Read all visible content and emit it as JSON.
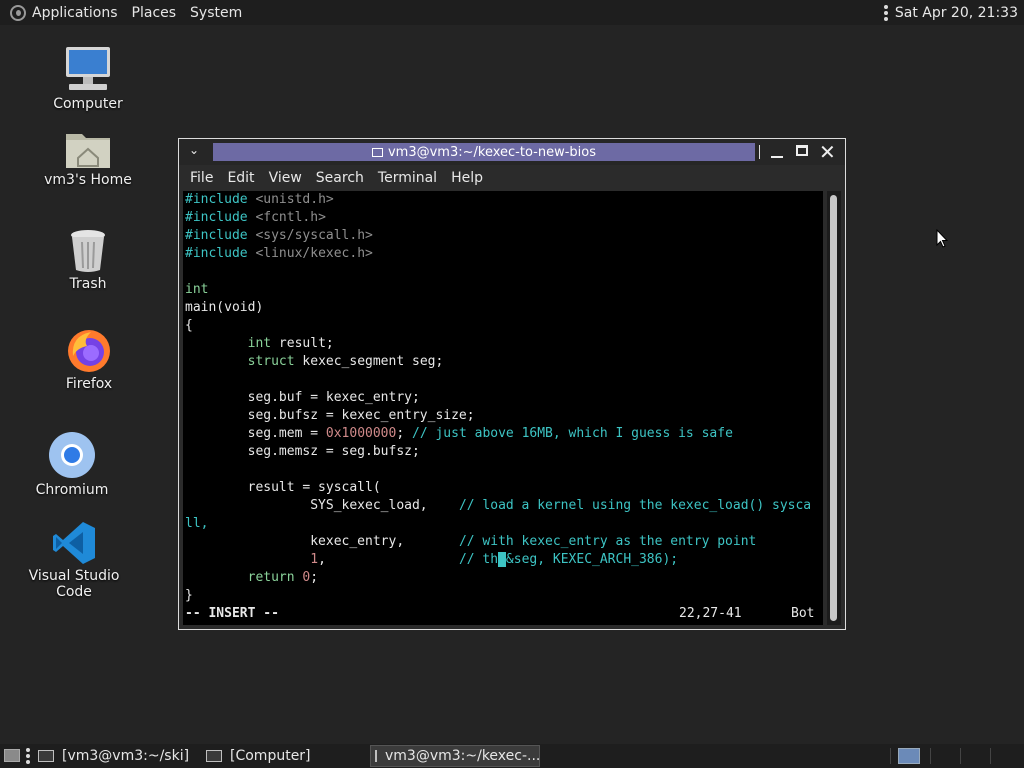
{
  "top_panel": {
    "menus": [
      "Applications",
      "Places",
      "System"
    ],
    "clock": "Sat Apr 20, 21:33"
  },
  "desktop_icons": [
    {
      "label": "Computer",
      "icon": "computer-icon"
    },
    {
      "label": "vm3's Home",
      "icon": "home-folder-icon"
    },
    {
      "label": "Trash",
      "icon": "trash-icon"
    },
    {
      "label": "Firefox",
      "icon": "firefox-icon"
    },
    {
      "label": "Chromium",
      "icon": "chromium-icon"
    },
    {
      "label": "Visual Studio Code",
      "icon": "vscode-icon"
    }
  ],
  "terminal": {
    "title": "vm3@vm3:~/kexec-to-new-bios",
    "menu": [
      "File",
      "Edit",
      "View",
      "Search",
      "Terminal",
      "Help"
    ],
    "code": {
      "l1a": "#include",
      "l1b": " <unistd.h>",
      "l2a": "#include",
      "l2b": " <fcntl.h>",
      "l3a": "#include",
      "l3b": " <sys/syscall.h>",
      "l4a": "#include",
      "l4b": " <linux/kexec.h>",
      "l6": "int",
      "l7": "main(void)",
      "l8": "{",
      "l9a": "        ",
      "l9b": "int",
      "l9c": " result;",
      "l10a": "        ",
      "l10b": "struct",
      "l10c": " kexec_segment seg;",
      "l12": "        seg.buf = kexec_entry;",
      "l13": "        seg.bufsz = kexec_entry_size;",
      "l14a": "        seg.mem = ",
      "l14b": "0x1000000",
      "l14c": "; ",
      "l14d": "// just above 16MB, which I guess is safe",
      "l15": "        seg.memsz = seg.bufsz;",
      "l17": "        result = syscall(",
      "l18a": "                SYS_kexec_load,    ",
      "l18b": "// load a kernel using the kexec_load() sysca",
      "l19": "ll,",
      "l20a": "                kexec_entry,       ",
      "l20b": "// with kexec_entry as the entry point",
      "l21a": "                ",
      "l21b": "1",
      "l21c": ",                 ",
      "l21d": "// th",
      "l21e": " ",
      "l21f": "&seg, KEXEC_ARCH_386);",
      "l22a": "        ",
      "l22b": "return",
      "l22c": " ",
      "l22d": "0",
      "l22e": ";",
      "l23": "}"
    },
    "status": {
      "mode": "-- INSERT --",
      "position": "22,27-41",
      "scroll": "Bot"
    }
  },
  "taskbar": {
    "tasks": [
      {
        "label": "[vm3@vm3:~/ski]"
      },
      {
        "label": "[Computer]"
      },
      {
        "label": "vm3@vm3:~/kexec-..."
      }
    ]
  }
}
